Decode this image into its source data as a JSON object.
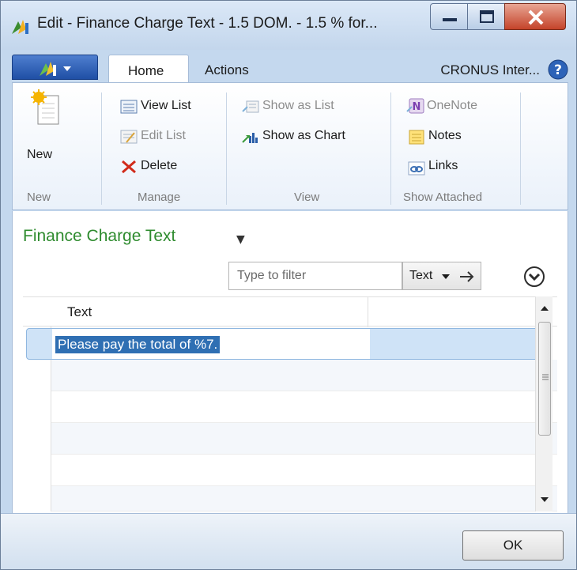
{
  "window": {
    "title": "Edit - Finance Charge Text - 1.5 DOM. - 1.5 % for..."
  },
  "ribbon": {
    "tabs": [
      "Home",
      "Actions"
    ],
    "company": "CRONUS Inter...",
    "groups": {
      "new": {
        "label": "New",
        "button": "New"
      },
      "manage": {
        "label": "Manage",
        "view_list": "View List",
        "edit_list": "Edit List",
        "delete": "Delete"
      },
      "view": {
        "label": "View",
        "show_as_list": "Show as List",
        "show_as_chart": "Show as Chart"
      },
      "show_attached": {
        "label": "Show Attached",
        "onenote": "OneNote",
        "notes": "Notes",
        "links": "Links"
      }
    }
  },
  "page": {
    "title": "Finance Charge Text",
    "filter": {
      "placeholder": "Type to filter",
      "field": "Text"
    }
  },
  "grid": {
    "columns": [
      "Text"
    ],
    "rows": [
      {
        "text": "Please pay the total of %7."
      }
    ]
  },
  "footer": {
    "ok": "OK"
  }
}
